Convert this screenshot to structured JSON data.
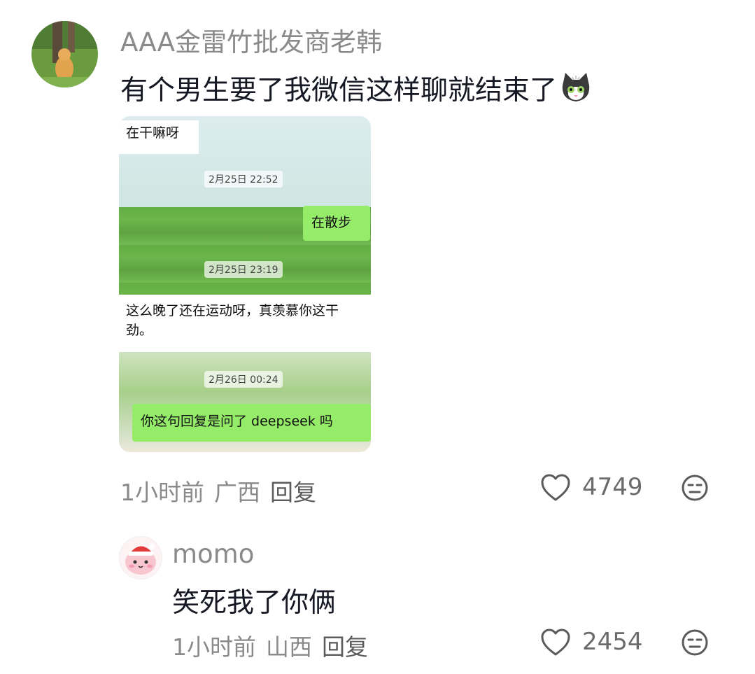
{
  "comments": [
    {
      "username": "AAA金雷竹批发商老韩",
      "text": "有个男生要了我微信这样聊就结束了",
      "emoji": "cat-emoji",
      "time": "1小时前",
      "location": "广西",
      "reply_label": "回复",
      "likes": "4749"
    },
    {
      "username": "momo",
      "text": "笑死我了你俩",
      "time": "1小时前",
      "location": "山西",
      "reply_label": "回复",
      "likes": "2454"
    }
  ],
  "chat_image": {
    "msg1": "在干嘛呀",
    "ts1": "2月25日 22:52",
    "msg2": "在散步",
    "ts2": "2月25日 23:19",
    "msg3": "这么晚了还在运动呀，真羡慕你这干劲。",
    "ts3": "2月26日 00:24",
    "msg4": "你这句回复是问了 deepseek 吗"
  },
  "colors": {
    "wechat_green": "#95ec69",
    "meta_gray": "#8a8a8a"
  },
  "icons": [
    "heart-icon",
    "dislike-face-icon"
  ]
}
